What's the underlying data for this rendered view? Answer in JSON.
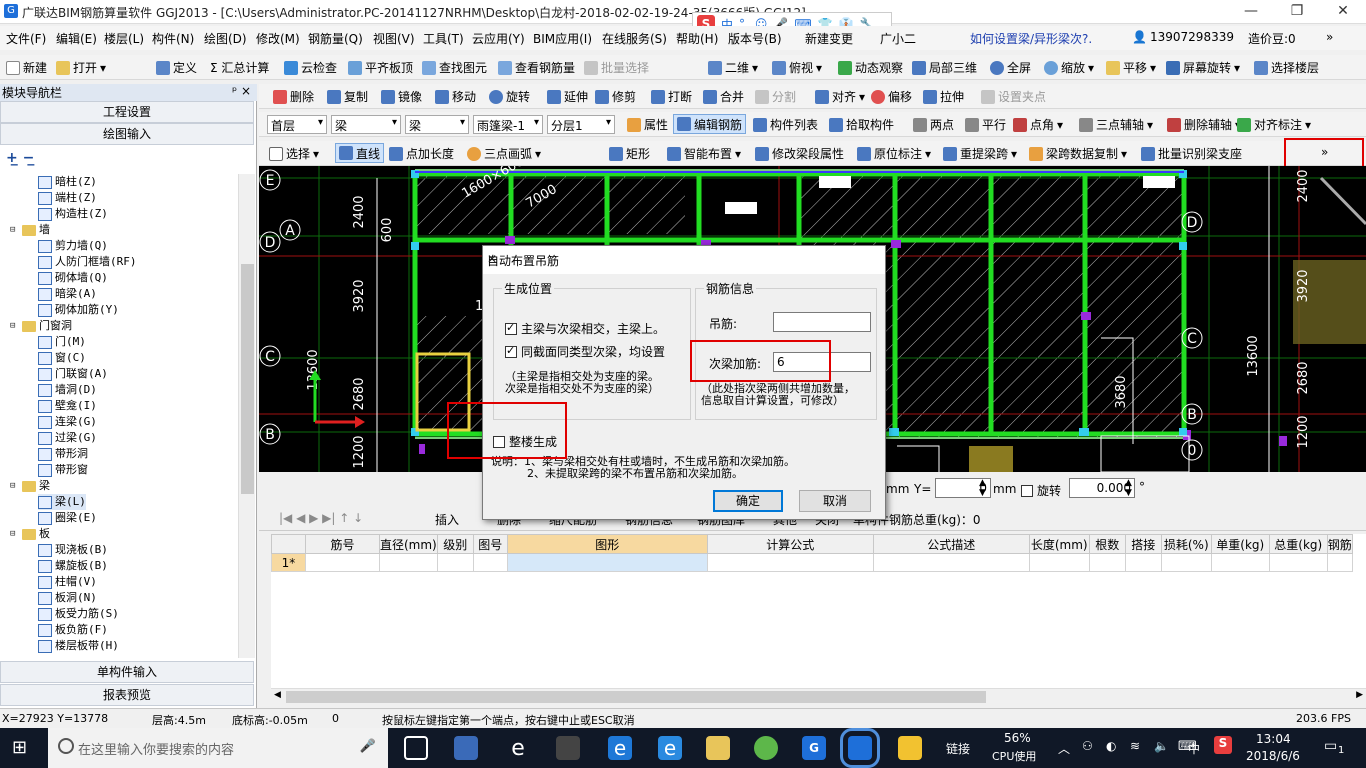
{
  "app": {
    "title": "广联达BIM钢筋算量软件 GGJ2013 - [C:\\Users\\Administrator.PC-20141127NRHM\\Desktop\\白龙村-2018-02-02-19-24-35(3666版).GGJ12]",
    "icon_label": "G"
  },
  "ime": {
    "s": "S",
    "items": [
      "中",
      "°,",
      "☺",
      "🎤",
      "⌨",
      "👕",
      "👔",
      "🔧"
    ]
  },
  "menu": {
    "items": [
      "文件(F)",
      "编辑(E)",
      "楼层(L)",
      "构件(N)",
      "绘图(D)",
      "修改(M)",
      "钢筋量(Q)",
      "视图(V)",
      "工具(T)",
      "云应用(Y)",
      "BIM应用(I)",
      "在线服务(S)",
      "帮助(H)",
      "版本号(B)",
      "新建变更",
      "广小二"
    ],
    "help_link": "如何设置梁/异形梁次?.",
    "phone": "13907298339",
    "points": "造价豆:0"
  },
  "toolbar1": {
    "items": [
      "新建",
      "打开",
      "定义",
      "Σ 汇总计算",
      "云检查",
      "平齐板顶",
      "查找图元",
      "查看钢筋量",
      "批量选择",
      "二维",
      "俯视",
      "动态观察",
      "局部三维",
      "全屏",
      "缩放",
      "平移",
      "屏幕旋转",
      "选择楼层"
    ]
  },
  "toolbar2": {
    "items": [
      "删除",
      "复制",
      "镜像",
      "移动",
      "旋转",
      "延伸",
      "修剪",
      "打断",
      "合并",
      "分割",
      "对齐",
      "偏移",
      "拉伸",
      "设置夹点"
    ]
  },
  "toolbar3": {
    "floor": "首层",
    "type1": "梁",
    "type2": "梁",
    "element": "雨篷梁-1",
    "layer": "分层1",
    "items": [
      "属性",
      "编辑钢筋",
      "构件列表",
      "拾取构件",
      "两点",
      "平行",
      "点角",
      "三点辅轴",
      "删除辅轴",
      "对齐标注"
    ]
  },
  "toolbar4": {
    "items": [
      "选择",
      "直线",
      "点加长度",
      "三点画弧",
      "矩形",
      "智能布置",
      "修改梁段属性",
      "原位标注",
      "重提梁跨",
      "梁跨数据复制",
      "批量识别梁支座"
    ]
  },
  "leftnav": {
    "header": "模块导航栏",
    "pin": "ᵖ ×",
    "btn_project": "工程设置",
    "btn_draw": "绘图输入",
    "btn_single": "单构件输入",
    "btn_report": "报表预览",
    "tree": [
      {
        "label": "暗柱(Z)",
        "level": 2
      },
      {
        "label": "端柱(Z)",
        "level": 2
      },
      {
        "label": "构造柱(Z)",
        "level": 2
      },
      {
        "label": "墙",
        "level": 1
      },
      {
        "label": "剪力墙(Q)",
        "level": 2
      },
      {
        "label": "人防门框墙(RF)",
        "level": 2
      },
      {
        "label": "砌体墙(Q)",
        "level": 2
      },
      {
        "label": "暗梁(A)",
        "level": 2
      },
      {
        "label": "砌体加筋(Y)",
        "level": 2
      },
      {
        "label": "门窗洞",
        "level": 1
      },
      {
        "label": "门(M)",
        "level": 2
      },
      {
        "label": "窗(C)",
        "level": 2
      },
      {
        "label": "门联窗(A)",
        "level": 2
      },
      {
        "label": "墙洞(D)",
        "level": 2
      },
      {
        "label": "壁龛(I)",
        "level": 2
      },
      {
        "label": "连梁(G)",
        "level": 2
      },
      {
        "label": "过梁(G)",
        "level": 2
      },
      {
        "label": "带形洞",
        "level": 2
      },
      {
        "label": "带形窗",
        "level": 2
      },
      {
        "label": "梁",
        "level": 1
      },
      {
        "label": "梁(L)",
        "level": 2
      },
      {
        "label": "圈梁(E)",
        "level": 2
      },
      {
        "label": "板",
        "level": 1
      },
      {
        "label": "现浇板(B)",
        "level": 2
      },
      {
        "label": "螺旋板(B)",
        "level": 2
      },
      {
        "label": "柱帽(V)",
        "level": 2
      },
      {
        "label": "板洞(N)",
        "level": 2
      },
      {
        "label": "板受力筋(S)",
        "level": 2
      },
      {
        "label": "板负筋(F)",
        "level": 2
      },
      {
        "label": "楼层板带(H)",
        "level": 2
      }
    ]
  },
  "canvas": {
    "axis_left": [
      "E",
      "D",
      "A",
      "C",
      "B"
    ],
    "axis_right": [
      "D",
      "C",
      "B",
      "0"
    ],
    "dims_left": [
      "2400",
      "3920",
      "2680",
      "1200"
    ],
    "dim_600": "600",
    "dim_13600": "13600",
    "dims_right": [
      "2400",
      "3920",
      "13600",
      "2680",
      "1200"
    ],
    "tags": [
      "1600×600",
      "7000",
      "3680"
    ],
    "num_1": "1"
  },
  "coordbar": {
    "mm": "mm",
    "y_label": "Y=",
    "y_value": "0",
    "mm2": "mm",
    "rotate": "旋转",
    "rotate_value": "0.000",
    "deg": "°"
  },
  "gridtoolbar": {
    "items": [
      "插入",
      "删除",
      "缩尺配筋",
      "钢筋信息",
      "钢筋图库",
      "其他",
      "关闭"
    ],
    "total": "单构件钢筋总重(kg)：0"
  },
  "grid": {
    "headers": [
      "",
      "筋号",
      "直径(mm)",
      "级别",
      "图号",
      "图形",
      "计算公式",
      "公式描述",
      "长度(mm)",
      "根数",
      "搭接",
      "损耗(%)",
      "单重(kg)",
      "总重(kg)",
      "钢筋"
    ],
    "row1_index": "1*"
  },
  "status": {
    "coords": "X=27923 Y=13778",
    "floor_height": "层高:4.5m",
    "base_height": "底标高:-0.05m",
    "zero": "0",
    "hint": "按鼠标左键指定第一个端点，按右键中止或ESC取消",
    "fps": "203.6 FPS"
  },
  "dialog": {
    "title": "自动布置吊筋",
    "close": "✕",
    "group_position": "生成位置",
    "chk_main": "主梁与次梁相交，主梁上。",
    "chk_same": "同截面同类型次梁，均设置",
    "note1": "（主梁是指相交处为支座的梁。",
    "note2": "次梁是指相交处不为支座的梁）",
    "group_rebar": "钢筋信息",
    "label_hanger": "吊筋:",
    "hanger_value": "",
    "label_secondary": "次梁加筋:",
    "secondary_value": "6",
    "rebar_note1": "（此处指次梁两侧共增加数量，",
    "rebar_note2": "信息取自计算设置，可修改）",
    "chk_whole": "整楼生成",
    "explain1": "说明：1、梁与梁相交处有柱或墙时，不生成吊筋和次梁加筋。",
    "explain2": "2、未提取梁跨的梁不布置吊筋和次梁加筋。",
    "ok": "确定",
    "cancel": "取消"
  },
  "taskbar": {
    "search_placeholder": "在这里输入你要搜索的内容",
    "link": "链接",
    "cpu_pct": "56%",
    "cpu_label": "CPU使用",
    "lang": "中",
    "time": "13:04",
    "date": "2018/6/6",
    "notif": "1"
  },
  "colors": {
    "accent": "#0078d7",
    "red_mark": "#e00000",
    "green_beam": "#22dd22",
    "taskbar": "#101827"
  }
}
